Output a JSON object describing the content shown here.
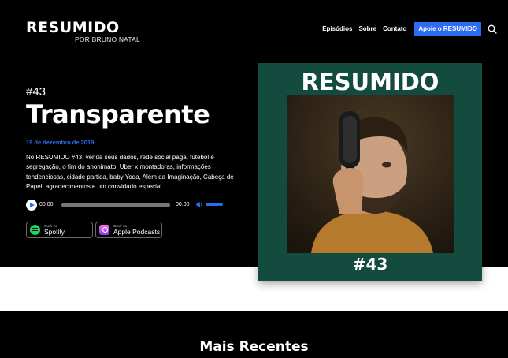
{
  "brand": {
    "title": "RESUMIDO",
    "subtitle": "POR BRUNO NATAL"
  },
  "nav": {
    "links": [
      "Episódios",
      "Sobre",
      "Contato"
    ],
    "cta_label": "Apoie o RESUMIDO",
    "search_icon": "search-icon"
  },
  "episode": {
    "number": "#43",
    "title": "Transparente",
    "date": "19 de dezembro de 2019",
    "description": "No RESUMIDO #43: venda seus dados, rede social paga, futebol e segregação, o fim do anonimato, Uber x montadoras, informações tendenciosas, cidade partida, baby Yoda, Além da Imaginação, Cabeça de Papel, agradecimentos e um convidado especial."
  },
  "player": {
    "current_time": "00:00",
    "duration": "00:00",
    "progress": 0,
    "volume": 1,
    "icons": {
      "play": "play-icon",
      "volume": "volume-icon"
    }
  },
  "badges": [
    {
      "small": "Ouvir no",
      "label": "Spotify",
      "icon": "spotify-icon"
    },
    {
      "small": "Ouvir no",
      "label": "Apple Podcasts",
      "icon": "apple-podcasts-icon"
    }
  ],
  "cover": {
    "title": "RESUMIDO",
    "number": "#43"
  },
  "section": {
    "title": "Mais Recentes"
  },
  "colors": {
    "accent": "#2c6bf2",
    "cover_bg": "#144b3f",
    "hero_bg": "#000000"
  }
}
